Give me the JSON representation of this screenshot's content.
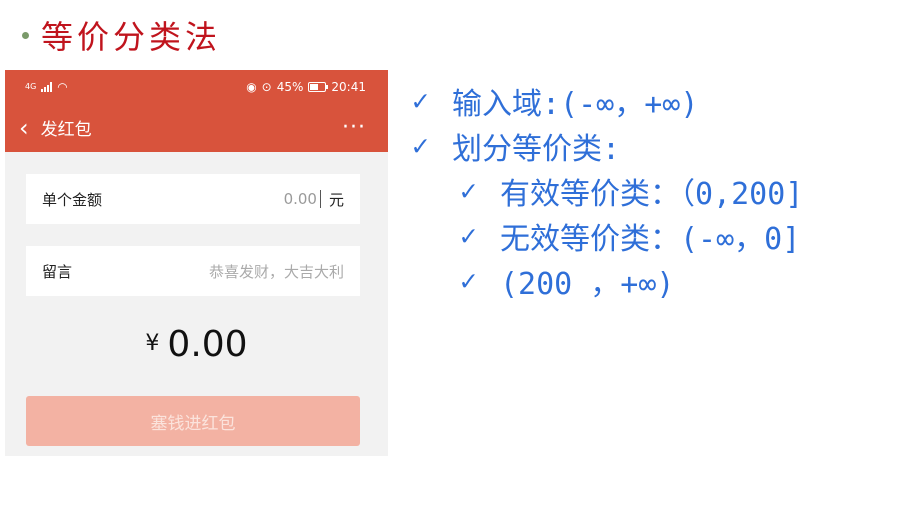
{
  "slide": {
    "title": "等价分类法"
  },
  "phone": {
    "status_bar": {
      "network": "4G",
      "battery": "45%",
      "time": "20:41",
      "icons": [
        "signal-icon",
        "wifi-icon",
        "eye-icon",
        "alarm-icon",
        "battery-icon"
      ]
    },
    "nav": {
      "back_icon": "‹",
      "title": "发红包",
      "more_icon": "···"
    },
    "amount_field": {
      "label": "单个金额",
      "value": "0.00",
      "unit": "元"
    },
    "message_field": {
      "label": "留言",
      "placeholder": "恭喜发财，大吉大利"
    },
    "total": {
      "currency": "¥",
      "value": "0.00"
    },
    "submit_button": {
      "label": "塞钱进红包"
    },
    "colors": {
      "header": "#d8533c",
      "button_disabled": "#f3b2a3",
      "background": "#f2f2f2"
    }
  },
  "notes": {
    "check_glyph": "✓",
    "items": [
      "输入域:(-∞，+∞)",
      "划分等价类:",
      "有效等价类：（0,200]",
      "无效等价类：(-∞，0]",
      "(200 ，+∞)"
    ],
    "color": "#2f6fd8"
  }
}
